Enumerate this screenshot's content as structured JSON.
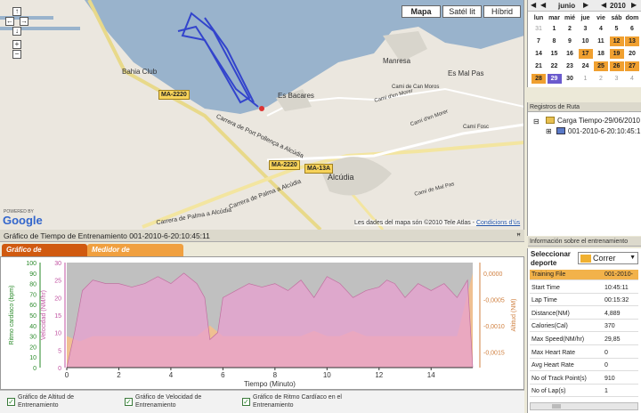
{
  "map": {
    "buttons": [
      "Mapa",
      "Satél lit",
      "Híbrid"
    ],
    "labels": {
      "bahia_club": "Bahia Club",
      "es_bacares": "Es Bacares",
      "manresa": "Manresa",
      "es_mal_pas": "Es Mal Pas",
      "alcudia": "Alcúdia",
      "road_port_pollenca": "Carrera de Port Pollença a Alcúdia",
      "road_palma": "Carrera de Palma a Alcúdia",
      "road_palma2": "Carrera de Palma a Alcúdia",
      "cami_morer": "Camí d'en Morer",
      "cami_morer2": "Camí d'en Morer",
      "cami_fosc": "Camí Fosc",
      "cami_moros": "Cami de Can Moros",
      "cami_mal_pas": "Camí de Mal Pas",
      "road_ma2220": "MA-2220",
      "road_ma2220b": "MA-2220",
      "road_ma13a": "MA-13A"
    },
    "google": "Google",
    "powered_by": "POWERED BY",
    "attribution": "Les dades del mapa són ©2010 Tele Atlas -",
    "terms": "Condicions d'ús"
  },
  "calendar": {
    "month": "junio",
    "year": "2010",
    "weekdays": [
      "lun",
      "mar",
      "mié",
      "jue",
      "vie",
      "sáb",
      "dom"
    ],
    "days": [
      [
        "31",
        "1",
        "2",
        "3",
        "4",
        "5",
        "6"
      ],
      [
        "7",
        "8",
        "9",
        "10",
        "11",
        "12",
        "13"
      ],
      [
        "14",
        "15",
        "16",
        "17",
        "18",
        "19",
        "20"
      ],
      [
        "21",
        "22",
        "23",
        "24",
        "25",
        "26",
        "27"
      ],
      [
        "28",
        "29",
        "30",
        "1",
        "2",
        "3",
        "4"
      ]
    ],
    "highlight_days": [
      "12",
      "13",
      "17",
      "19",
      "25",
      "26",
      "27",
      "28"
    ],
    "selected_day": "29",
    "colors": {
      "highlight": "#f0a030",
      "selected": "#6a5acd"
    }
  },
  "routes": {
    "title": "Registros de Ruta",
    "folder": "Carga Tiempo-29/06/2010",
    "item": "001-2010-6-20:10:45:1"
  },
  "info": {
    "title": "Información sobre el entrenamiento",
    "select_label": "Seleccionar deporte",
    "sport": "Correr",
    "rows": [
      {
        "k": "Training File",
        "v": "001-2010-"
      },
      {
        "k": "Start Time",
        "v": "10:45:11"
      },
      {
        "k": "Lap Time",
        "v": "00:15:32"
      },
      {
        "k": "Distance(NM)",
        "v": "4,889"
      },
      {
        "k": "Calories(Cal)",
        "v": "370"
      },
      {
        "k": "Max Speed(NM/hr)",
        "v": "29,85"
      },
      {
        "k": "Max Heart Rate",
        "v": "0"
      },
      {
        "k": "Avg Heart Rate",
        "v": "0"
      },
      {
        "k": "No of Track Point(s)",
        "v": "910"
      },
      {
        "k": "No of Lap(s)",
        "v": "1"
      }
    ]
  },
  "graph": {
    "title": "Gráfico de Tiempo de Entrenamiento 001-2010-6-20:10:45:11",
    "pin": "ꟸ",
    "tabs": [
      "Gráfico de Entrenamiento",
      "Medidor de Entrenamiento"
    ],
    "legend": [
      "Gráfico de Altitud de Entrenamiento",
      "Gráfico de Velocidad de Entrenamiento",
      "Gráfico de Ritmo Cardíaco en el Entrenamiento"
    ]
  },
  "chart_data": {
    "type": "area",
    "xlabel": "Tiempo (Minuto)",
    "x_ticks": [
      "0",
      "2",
      "4",
      "6",
      "8",
      "10",
      "12",
      "14"
    ],
    "xlim": [
      0,
      15.6
    ],
    "axes": [
      {
        "label": "Ritmo cardiaco (bpm)",
        "ticks": [
          "100",
          "90",
          "80",
          "70",
          "60",
          "50",
          "40",
          "30",
          "20",
          "10",
          "0"
        ],
        "range": [
          0,
          100
        ]
      },
      {
        "label": "Velocidad (NM/hr)",
        "ticks": [
          "30",
          "25",
          "20",
          "15",
          "10",
          "5",
          "0"
        ],
        "range": [
          0,
          30
        ]
      },
      {
        "label": "Altitud (NM)",
        "ticks": [
          "0,0000",
          "-0,0005",
          "-0,0010",
          "-0,0015"
        ],
        "range": [
          -0.0018,
          0.0002
        ]
      }
    ],
    "series": [
      {
        "name": "Velocidad",
        "color": "#e8a0d0",
        "x": [
          0,
          0.3,
          0.6,
          1,
          1.5,
          2,
          2.5,
          3,
          3.5,
          4,
          4.5,
          5,
          5.3,
          5.5,
          5.8,
          6,
          6.5,
          7,
          7.5,
          8,
          8.5,
          9,
          9.5,
          10,
          10.5,
          11,
          11.5,
          12,
          12.3,
          12.6,
          13,
          13.5,
          14,
          14.5,
          15,
          15.4,
          15.6
        ],
        "y": [
          0,
          10,
          22,
          25,
          24,
          24,
          23,
          24,
          26,
          24,
          27,
          24,
          20,
          8,
          10,
          20,
          22,
          24,
          23,
          24,
          22,
          25,
          20,
          26,
          24,
          20,
          22,
          23,
          25,
          24,
          20,
          24,
          22,
          24,
          20,
          25,
          0
        ]
      },
      {
        "name": "Altitud",
        "color": "#f4c08c",
        "x": [
          0,
          0.5,
          1,
          1.5,
          2,
          2.5,
          3,
          3.5,
          4,
          4.5,
          5,
          5.5,
          6,
          6.5,
          7,
          7.5,
          8,
          8.5,
          9,
          9.5,
          10,
          10.5,
          11,
          11.5,
          12,
          12.5,
          13,
          13.5,
          14,
          14.5,
          15,
          15.6
        ],
        "y": [
          -0.0012,
          -0.0013,
          -0.0012,
          -0.0012,
          -0.0012,
          -0.0012,
          -0.0012,
          -0.0012,
          -0.0012,
          -0.0012,
          -0.0012,
          -0.001,
          -0.0012,
          -0.0012,
          -0.0012,
          -0.0012,
          -0.0012,
          -0.0012,
          -0.0012,
          -0.0011,
          -0.0012,
          -0.0012,
          -0.0011,
          -0.0012,
          -0.0012,
          -0.0012,
          -0.0012,
          -0.0012,
          -0.0012,
          -0.0012,
          -0.0012,
          0.0
        ]
      }
    ]
  }
}
